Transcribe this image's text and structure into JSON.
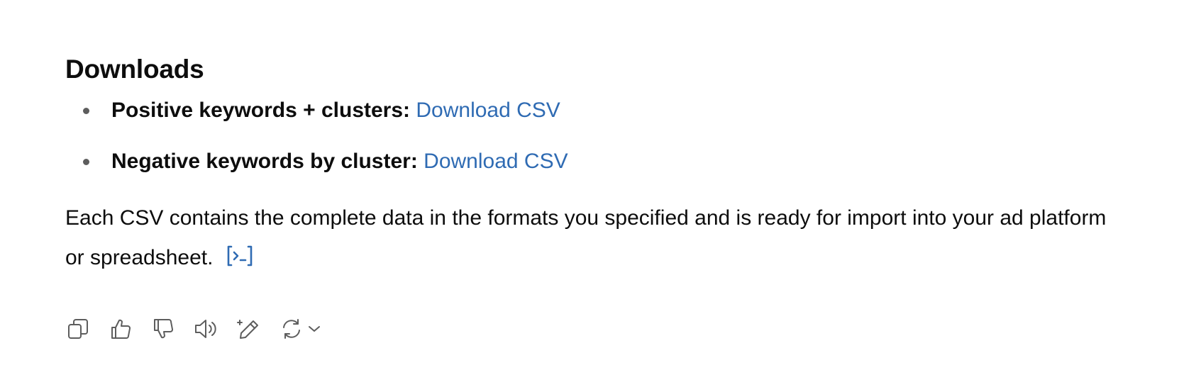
{
  "message": {
    "heading": "Downloads",
    "downloads": [
      {
        "label": "Positive keywords + clusters:",
        "link_text": "Download CSV"
      },
      {
        "label": "Negative keywords by cluster:",
        "link_text": "Download CSV"
      }
    ],
    "summary": "Each CSV contains the complete data in the formats you specified and is ready for import into your ad platform or spreadsheet."
  },
  "colors": {
    "link": "#2f6bb3",
    "text": "#0d0d0d",
    "icon": "#5d5d5d"
  },
  "actions": [
    {
      "name": "copy-button",
      "icon": "copy-icon"
    },
    {
      "name": "thumbs-up-button",
      "icon": "thumbs-up-icon"
    },
    {
      "name": "thumbs-down-button",
      "icon": "thumbs-down-icon"
    },
    {
      "name": "read-aloud-button",
      "icon": "speaker-icon"
    },
    {
      "name": "edit-button",
      "icon": "sparkle-pencil-icon"
    },
    {
      "name": "regenerate-button",
      "icon": "refresh-icon"
    }
  ]
}
